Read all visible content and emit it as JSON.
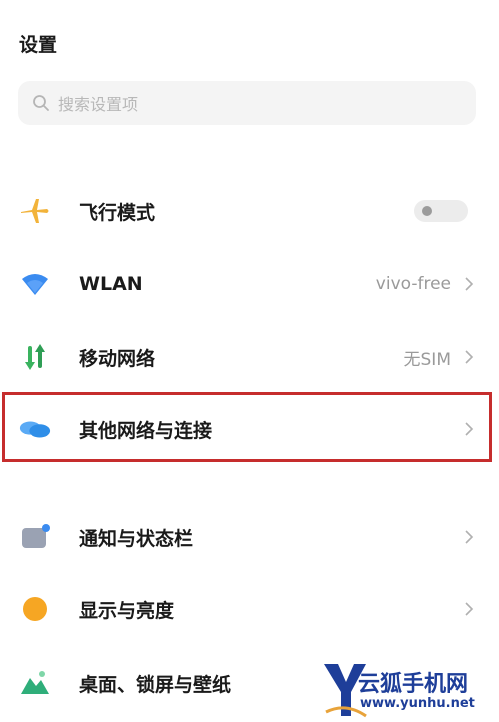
{
  "header": {
    "title": "设置"
  },
  "search": {
    "placeholder": "搜索设置项"
  },
  "settings": [
    {
      "label": "飞行模式",
      "icon": "airplane-icon",
      "control": "toggle",
      "toggle_on": false
    },
    {
      "label": "WLAN",
      "icon": "wifi-icon",
      "value": "vivo-free"
    },
    {
      "label": "移动网络",
      "icon": "mobile-data-icon",
      "value": "无SIM"
    },
    {
      "label": "其他网络与连接",
      "icon": "cloud-connections-icon",
      "value": ""
    },
    {
      "label": "通知与状态栏",
      "icon": "notification-icon",
      "value": ""
    },
    {
      "label": "显示与亮度",
      "icon": "sun-icon",
      "value": ""
    },
    {
      "label": "桌面、锁屏与壁纸",
      "icon": "wallpaper-icon",
      "value": ""
    }
  ],
  "watermark": {
    "name": "云狐手机网",
    "url": "www.yunhu.net"
  },
  "colors": {
    "highlight": "#c62d2d",
    "airplane": "#f2b33a",
    "wifi": "#3a8bf0",
    "mobile_green": "#3ab35f",
    "cloud_blue": "#2f8ee8",
    "sun": "#f6a623",
    "watermark": "#1e3e99"
  }
}
